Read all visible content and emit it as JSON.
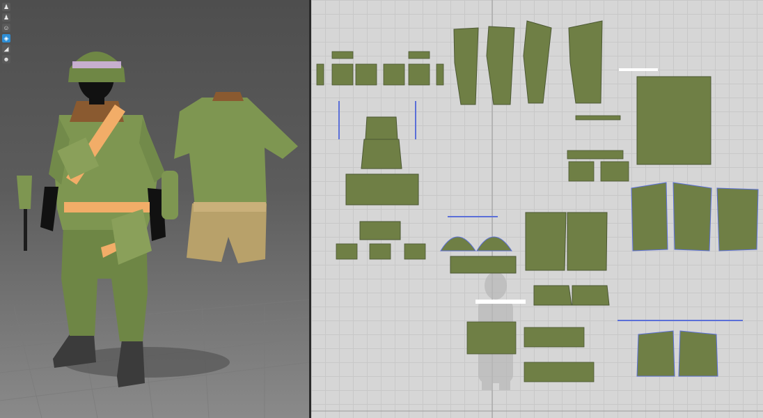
{
  "app": {
    "panels": [
      "3d-avatar-window",
      "2d-pattern-window"
    ]
  },
  "viewport3d": {
    "toolbar": [
      {
        "icon": "avatar-full-icon",
        "glyph": "♟",
        "active": false
      },
      {
        "icon": "avatar-garment-icon",
        "glyph": "♟",
        "active": false
      },
      {
        "icon": "avatar-only-icon",
        "glyph": "☺",
        "active": false
      },
      {
        "icon": "garment-display-icon",
        "glyph": "◈",
        "active": true
      },
      {
        "icon": "texture-icon",
        "glyph": "◢",
        "active": false
      },
      {
        "icon": "avatar-skin-icon",
        "glyph": "☻",
        "active": false
      }
    ],
    "scene": {
      "avatar": "soldier-figure",
      "garments": [
        "helmet",
        "field-jacket",
        "trousers",
        "webbing-belt",
        "boots"
      ],
      "props": [
        "shovel",
        "tshirt-and-shorts-form"
      ],
      "colors": {
        "olive": "#7e9651",
        "olive_dark": "#5f733a",
        "strap_orange": "#f2ad68",
        "shorts_tan": "#b8a16a",
        "boot": "#3b3b3b",
        "skin": "#111111",
        "floor_grid": "#7a7a7a"
      }
    }
  },
  "pattern2d": {
    "colors": {
      "piece_fill": "#6f7f45",
      "piece_stroke": "#4b5733",
      "seam_red": "#c85a4a",
      "seam_blue": "#5b6fd8",
      "white_bar": "#ffffff",
      "grid_bg": "#d6d6d6"
    },
    "pieces": [
      "trouser-front-left",
      "trouser-back-left",
      "trouser-front-right",
      "trouser-back-right",
      "large-panel",
      "jacket-front-left",
      "jacket-back",
      "jacket-front-right",
      "sleeve-left",
      "sleeve-right",
      "helmet-cover-left",
      "helmet-cover-right",
      "tshirt-front",
      "tshirt-back",
      "shorts-front",
      "shorts-back",
      "pack-body",
      "pack-lid",
      "pocket-set",
      "strap-set"
    ]
  }
}
